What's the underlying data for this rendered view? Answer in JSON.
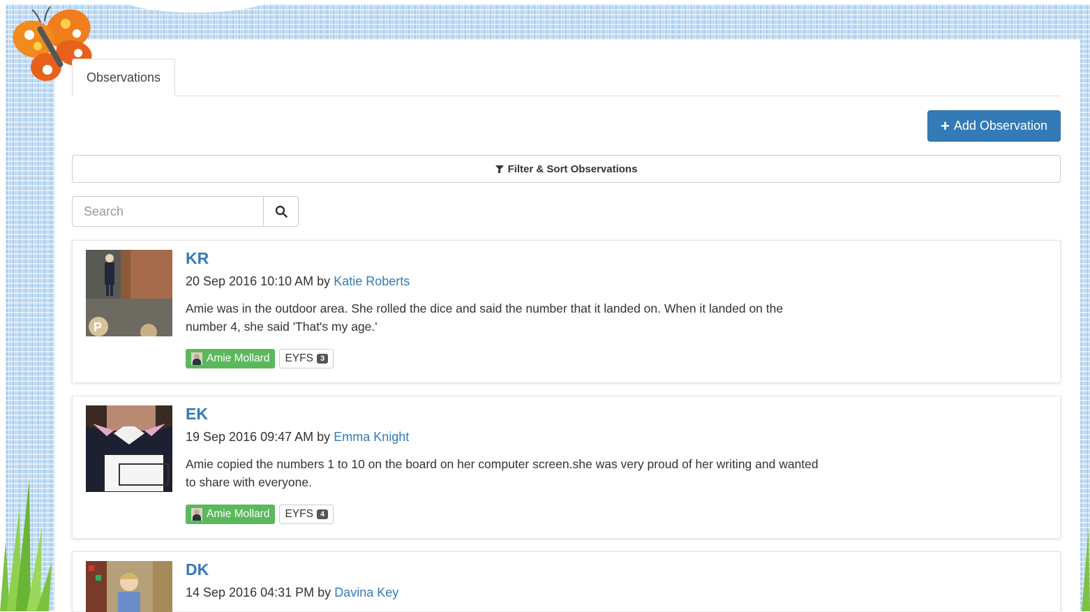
{
  "tabs": [
    {
      "label": "Observations"
    }
  ],
  "toolbar": {
    "add_label": "Add Observation"
  },
  "filter": {
    "label": "Filter & Sort Observations"
  },
  "search": {
    "placeholder": "Search"
  },
  "observations": [
    {
      "initials": "KR",
      "datetime": "20 Sep 2016 10:10 AM",
      "by": "by",
      "author": "Katie Roberts",
      "text": "Amie was in the outdoor area. She rolled the dice and said the number that it landed on. When it landed on the number 4, she said 'That's my age.'",
      "child": "Amie Mollard",
      "framework": "EYFS",
      "count": "3"
    },
    {
      "initials": "EK",
      "datetime": "19 Sep 2016 09:47 AM",
      "by": "by",
      "author": "Emma Knight",
      "text": "Amie copied the numbers 1 to 10 on the board on her computer screen.she was very proud of her writing and wanted to share with everyone.",
      "child": "Amie Mollard",
      "framework": "EYFS",
      "count": "4"
    },
    {
      "initials": "DK",
      "datetime": "14 Sep 2016 04:31 PM",
      "by": "by",
      "author": "Davina Key"
    }
  ],
  "colors": {
    "primary": "#337ab7",
    "success": "#5cb85c",
    "frame": "#bcd9f3"
  }
}
